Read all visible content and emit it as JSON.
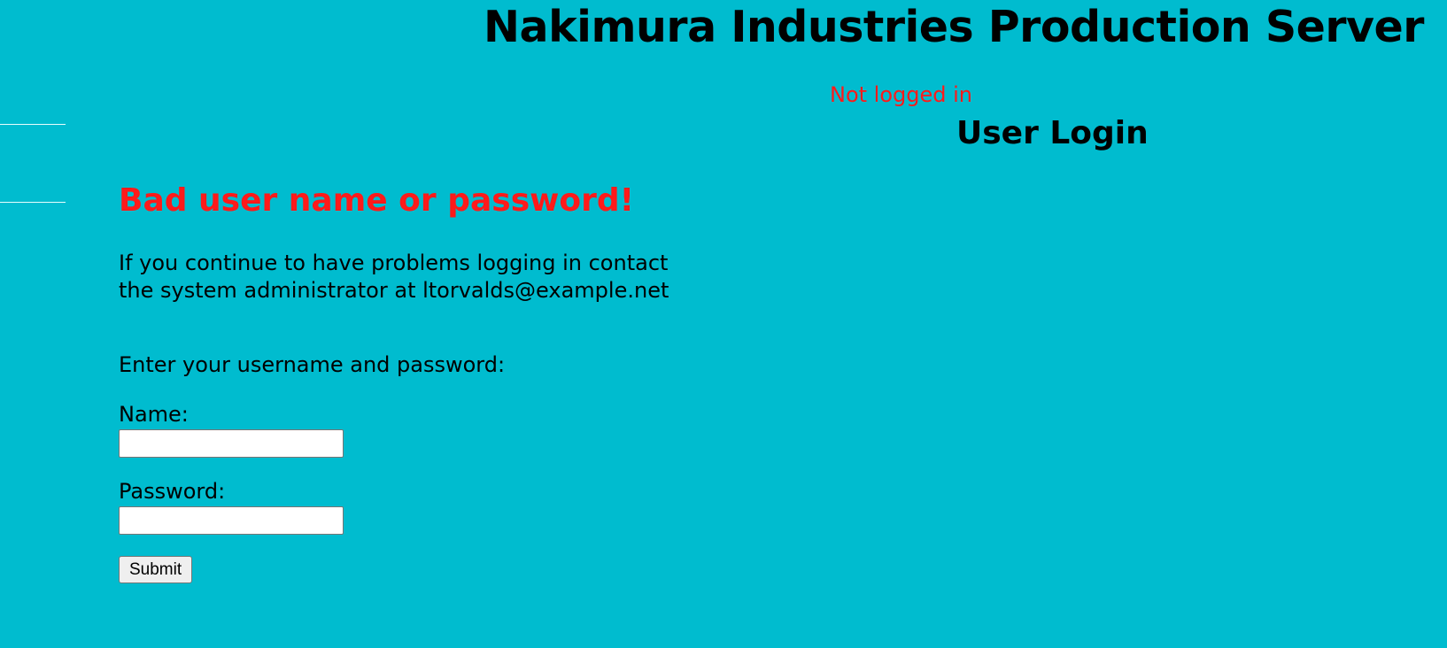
{
  "header": {
    "site_title": "Nakimura Industries Production Server",
    "login_status": "Not logged in"
  },
  "login": {
    "heading": "User Login",
    "error_message": "Bad user name or password!",
    "help_text": "If you continue to have problems logging in contact the system administrator at ltorvalds@example.net",
    "prompt": "Enter your username and password:",
    "name_label": "Name:",
    "name_value": "",
    "password_label": "Password:",
    "password_value": "",
    "submit_label": "Submit"
  },
  "colors": {
    "background": "#00bccf",
    "error_text": "#ff1a1a",
    "title_text": "#000000"
  }
}
